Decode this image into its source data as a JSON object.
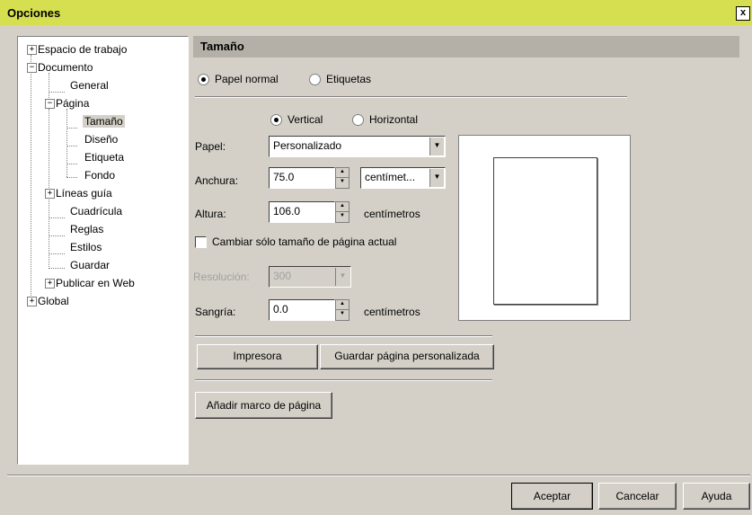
{
  "window": {
    "title": "Opciones",
    "close_glyph": "x"
  },
  "tree": {
    "items": [
      {
        "label": "Espacio de trabajo",
        "expander": "+"
      },
      {
        "label": "Documento",
        "expander": "−"
      },
      {
        "label": "General"
      },
      {
        "label": "Página",
        "expander": "−"
      },
      {
        "label": "Tamaño",
        "selected": true
      },
      {
        "label": "Diseño"
      },
      {
        "label": "Etiqueta"
      },
      {
        "label": "Fondo"
      },
      {
        "label": "Líneas guía",
        "expander": "+"
      },
      {
        "label": "Cuadrícula"
      },
      {
        "label": "Reglas"
      },
      {
        "label": "Estilos"
      },
      {
        "label": "Guardar"
      },
      {
        "label": "Publicar en Web",
        "expander": "+"
      },
      {
        "label": "Global",
        "expander": "+"
      }
    ]
  },
  "panel": {
    "header": "Tamaño",
    "paper_type": {
      "normal": "Papel normal",
      "labels": "Etiquetas",
      "selected": "normal"
    },
    "orientation": {
      "vertical": "Vertical",
      "horizontal": "Horizontal",
      "selected": "vertical"
    },
    "paper": {
      "label": "Papel:",
      "value": "Personalizado"
    },
    "width": {
      "label": "Anchura:",
      "value": "75.0",
      "unit": "centímet..."
    },
    "height": {
      "label": "Altura:",
      "value": "106.0",
      "unit": "centímetros"
    },
    "current_page_only": {
      "label": "Cambiar sólo tamaño de página actual",
      "checked": false
    },
    "resolution": {
      "label": "Resolución:",
      "value": "300"
    },
    "bleed": {
      "label": "Sangría:",
      "value": "0.0",
      "unit": "centímetros"
    },
    "buttons": {
      "printer": "Impresora",
      "save_custom": "Guardar página personalizada",
      "add_frame": "Añadir marco de página"
    }
  },
  "footer": {
    "ok": "Aceptar",
    "cancel": "Cancelar",
    "help": "Ayuda"
  }
}
